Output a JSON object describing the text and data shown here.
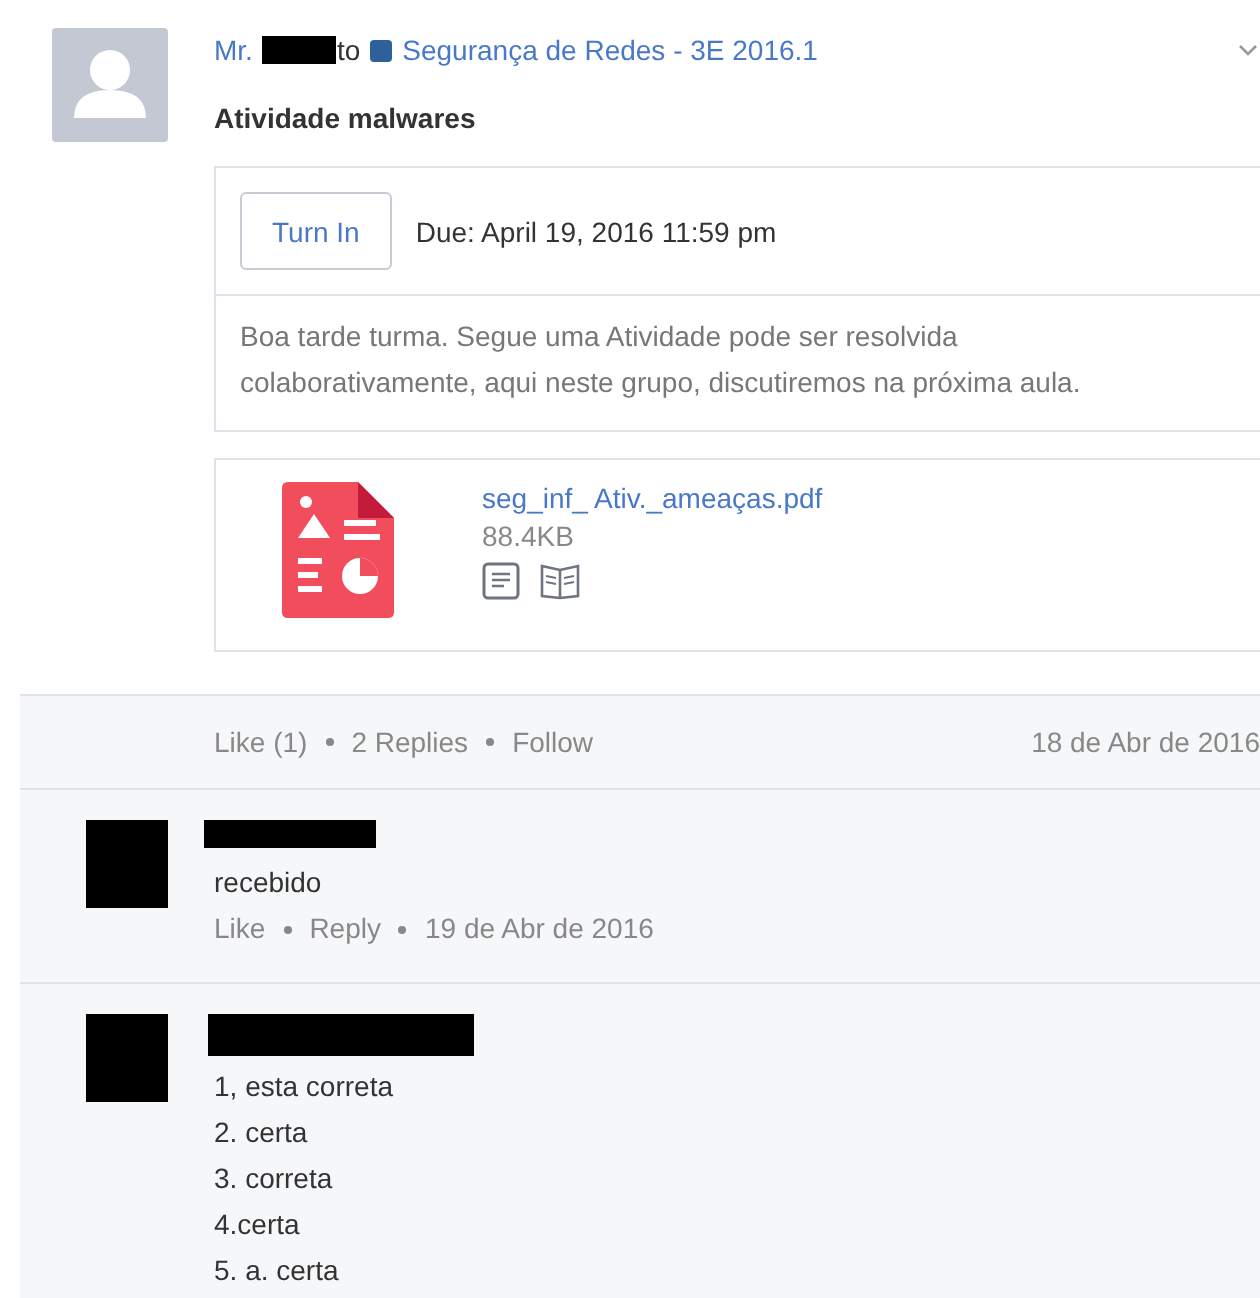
{
  "post": {
    "author_prefix": "Mr.",
    "author_suffix": "to",
    "group": "Segurança de Redes - 3E 2016.1",
    "title": "Atividade malwares",
    "turn_in": "Turn In",
    "due": "Due: April 19, 2016 11:59 pm",
    "body": "Boa tarde turma. Segue uma Atividade pode ser resolvida colaborativamente, aqui neste grupo, discutiremos na próxima aula.",
    "attachment": {
      "name": "seg_inf_ Ativ._ameaças.pdf",
      "size": "88.4KB"
    },
    "actions": [
      "Like (1)",
      "2 Replies",
      "Follow"
    ],
    "date": "18 de Abr de 2016"
  },
  "replies": [
    {
      "lines": [
        "recebido"
      ],
      "actions": [
        "Like",
        "Reply"
      ],
      "date": "19 de Abr de 2016"
    },
    {
      "lines": [
        "1, esta correta",
        "2. certa",
        "3. correta",
        "4.certa",
        "5. a. certa"
      ]
    }
  ]
}
